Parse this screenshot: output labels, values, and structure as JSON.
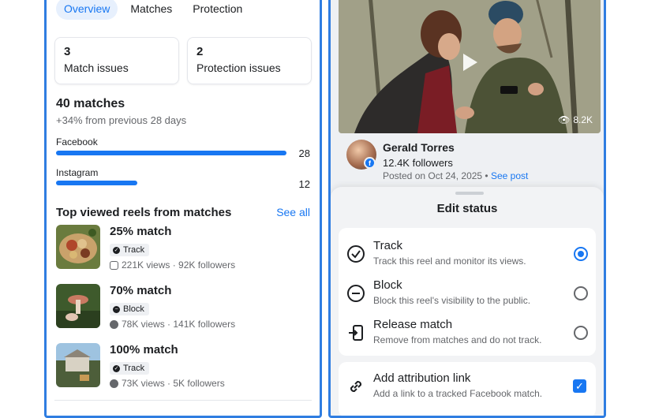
{
  "left": {
    "tabs": [
      {
        "label": "Overview",
        "active": true
      },
      {
        "label": "Matches",
        "active": false
      },
      {
        "label": "Protection",
        "active": false
      }
    ],
    "cards": [
      {
        "count": "3",
        "label": "Match issues"
      },
      {
        "count": "2",
        "label": "Protection issues"
      }
    ],
    "total": "40 matches",
    "change": "+34% from previous 28 days",
    "platforms": [
      {
        "name": "Facebook",
        "count": "28",
        "value": 28
      },
      {
        "name": "Instagram",
        "count": "12",
        "value": 12
      }
    ],
    "section_title": "Top viewed reels from matches",
    "see_all": "See all",
    "reels": [
      {
        "match": "25% match",
        "status": "Track",
        "status_icon": "check-icon",
        "platform_icon": "instagram-icon",
        "stats": "221K views · 92K followers"
      },
      {
        "match": "70% match",
        "status": "Block",
        "status_icon": "minus-icon",
        "platform_icon": "facebook-icon",
        "stats": "78K views · 141K followers"
      },
      {
        "match": "100% match",
        "status": "Track",
        "status_icon": "check-icon",
        "platform_icon": "facebook-icon",
        "stats": "73K views · 5K followers"
      }
    ]
  },
  "right": {
    "video_views": "8.2K",
    "poster": {
      "name": "Gerald Torres",
      "followers": "12.4K followers",
      "posted": "Posted on Oct 24, 2025 • ",
      "see_post": "See post"
    },
    "sheet": {
      "title": "Edit status",
      "options": [
        {
          "title": "Track",
          "desc": "Track this reel and monitor its views.",
          "icon": "check-circle-icon",
          "selected": true
        },
        {
          "title": "Block",
          "desc": "Block this reel's visibility to the public.",
          "icon": "minus-circle-icon",
          "selected": false
        },
        {
          "title": "Release match",
          "desc": "Remove from matches and do not track.",
          "icon": "release-icon",
          "selected": false
        }
      ],
      "attribution": {
        "title": "Add attribution link",
        "desc": "Add a link to a tracked Facebook match.",
        "icon": "link-icon",
        "checked": true
      }
    }
  },
  "colors": {
    "accent": "#1877f2",
    "frame": "#2f7de1",
    "muted": "#65676b"
  }
}
